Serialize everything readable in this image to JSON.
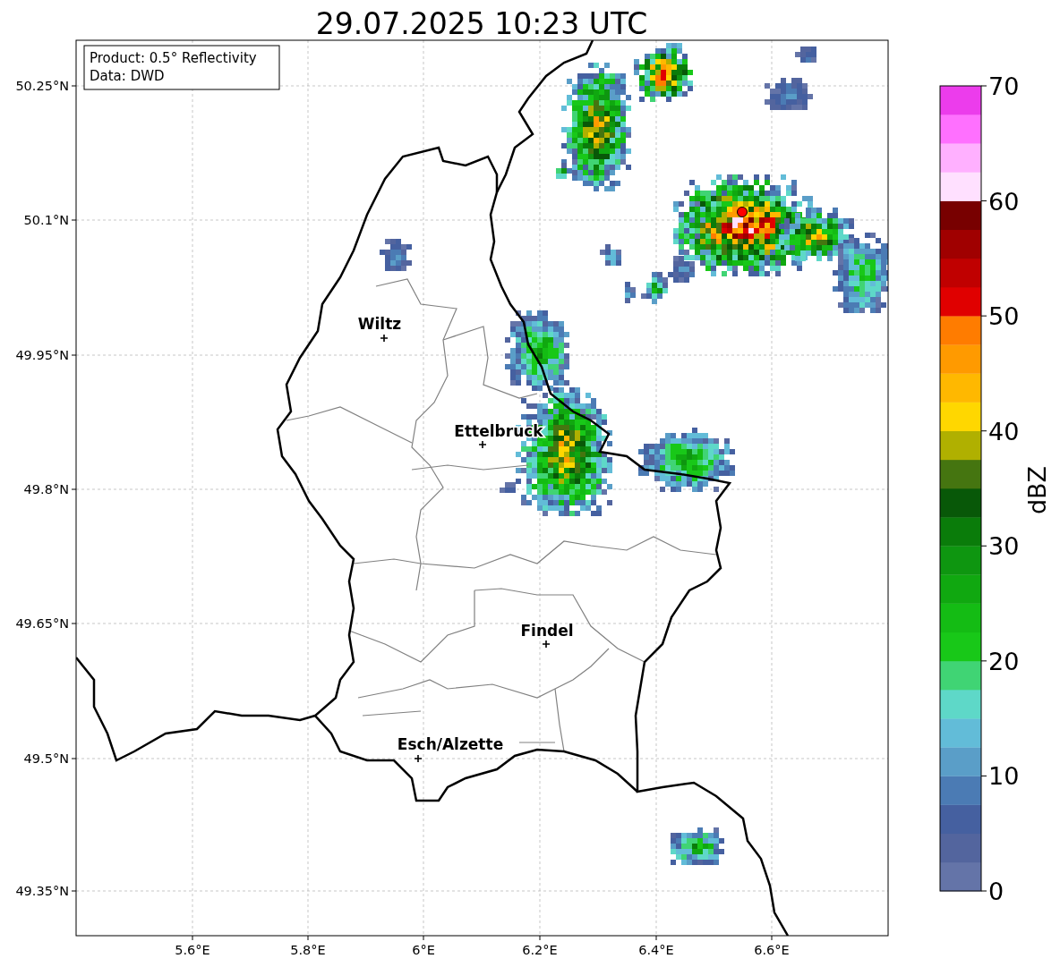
{
  "title": "29.07.2025 10:23 UTC",
  "info_box": {
    "lines": [
      "Product: 0.5° Reflectivity",
      "Data: DWD"
    ]
  },
  "map": {
    "cities": [
      "Wiltz",
      "Ettelbruck",
      "Findel",
      "Esch/Alzette"
    ],
    "x_ticks": [
      "5.6°E",
      "5.8°E",
      "6°E",
      "6.2°E",
      "6.4°E",
      "6.6°E"
    ],
    "y_ticks": [
      "50.25°N",
      "50.1°N",
      "49.95°N",
      "49.8°N",
      "49.65°N",
      "49.5°N",
      "49.35°N"
    ]
  },
  "colorbar": {
    "label": "dBZ",
    "ticks": [
      "70",
      "60",
      "50",
      "40",
      "30",
      "20",
      "10",
      "0"
    ],
    "segments": [
      {
        "color": "#6474a8"
      },
      {
        "color": "#53659e"
      },
      {
        "color": "#4560a0"
      },
      {
        "color": "#4b7bb4"
      },
      {
        "color": "#5a9ec8"
      },
      {
        "color": "#62bcd8"
      },
      {
        "color": "#5ed8c8"
      },
      {
        "color": "#40d474"
      },
      {
        "color": "#18c818"
      },
      {
        "color": "#14bc14"
      },
      {
        "color": "#10a810"
      },
      {
        "color": "#0e9610"
      },
      {
        "color": "#0a7c0a"
      },
      {
        "color": "#085808"
      },
      {
        "color": "#457510"
      },
      {
        "color": "#b0b000"
      },
      {
        "color": "#ffd700"
      },
      {
        "color": "#ffb800"
      },
      {
        "color": "#ff9a00"
      },
      {
        "color": "#ff7c00"
      },
      {
        "color": "#e00000"
      },
      {
        "color": "#c00000"
      },
      {
        "color": "#a00000"
      },
      {
        "color": "#780000"
      },
      {
        "color": "#ffe0ff"
      },
      {
        "color": "#ffb0ff"
      },
      {
        "color": "#ff70ff"
      },
      {
        "color": "#ec3cec"
      }
    ]
  }
}
